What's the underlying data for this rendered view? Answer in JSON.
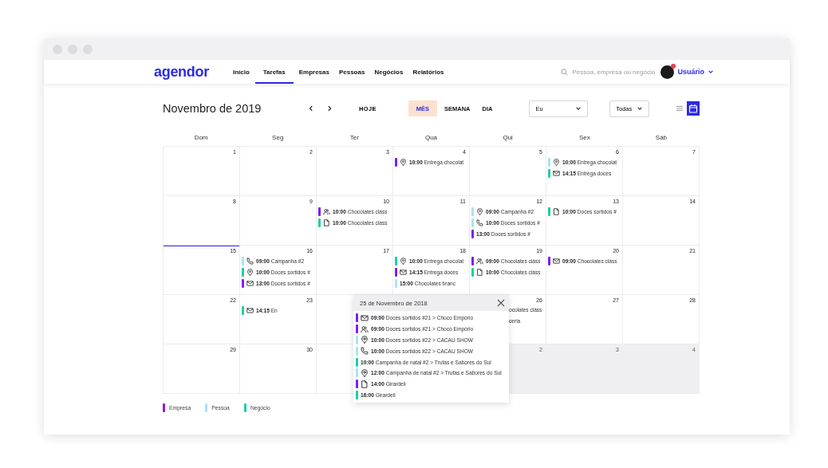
{
  "nav": {
    "logo": "agendor",
    "items": [
      {
        "label": "Início",
        "selected": false
      },
      {
        "label": "Tarefas",
        "selected": true
      },
      {
        "label": "Empresas",
        "selected": false
      },
      {
        "label": "Pessoas",
        "selected": false
      },
      {
        "label": "Negócios",
        "selected": false
      },
      {
        "label": "Relatórios",
        "selected": false
      }
    ],
    "search": {
      "placeholder": "Pessoa, empresa ou negócio"
    },
    "user": {
      "name": "Usuário",
      "notification": true
    }
  },
  "toolbar": {
    "title": "Novembro de 2019",
    "today_button": "HOJE",
    "views": [
      {
        "label": "MÊS",
        "selected": true
      },
      {
        "label": "SEMANA",
        "selected": false
      },
      {
        "label": "DIA",
        "selected": false
      }
    ],
    "filters": [
      {
        "value": "Eu"
      },
      {
        "value": "Todas"
      }
    ],
    "display_modes": [
      {
        "kind": "list",
        "selected": false
      },
      {
        "kind": "calendar",
        "selected": true
      }
    ]
  },
  "calendar": {
    "weekdays": [
      "Dom",
      "Seg",
      "Ter",
      "Qua",
      "Qui",
      "Sex",
      "Sáb"
    ],
    "weeks": [
      [
        {
          "day": "1",
          "today": false,
          "outside": false
        },
        {
          "day": "2",
          "today": false,
          "outside": false
        },
        {
          "day": "3",
          "today": false,
          "outside": false
        },
        {
          "day": "4",
          "today": false,
          "outside": false,
          "events": [
            {
              "time": "10:00",
              "title": "Entrega chocolat",
              "kind": "visit",
              "color": "#7e1ff0"
            }
          ]
        },
        {
          "day": "5",
          "today": false,
          "outside": false
        },
        {
          "day": "6",
          "today": false,
          "outside": false,
          "events": [
            {
              "time": "10:00",
              "title": "Entrega chocolat",
              "kind": "visit",
              "color": "#a9e3f7"
            },
            {
              "time": "14:15",
              "title": "Entrega doces",
              "kind": "email",
              "color": "#1ccfa4"
            }
          ]
        },
        {
          "day": "7",
          "today": false,
          "outside": false
        }
      ],
      [
        {
          "day": "8",
          "today": false,
          "outside": false
        },
        {
          "day": "9",
          "today": false,
          "outside": false
        },
        {
          "day": "10",
          "today": false,
          "outside": false,
          "events": [
            {
              "time": "10:00",
              "title": "Chocolates cláss",
              "kind": "meeting",
              "color": "#7e1ff0"
            },
            {
              "time": "10:00",
              "title": "Chocolates cláss",
              "kind": "proposal",
              "color": "#1ccfa4"
            }
          ]
        },
        {
          "day": "11",
          "today": false,
          "outside": false
        },
        {
          "day": "12",
          "today": false,
          "outside": false,
          "events": [
            {
              "time": "09:00",
              "title": "Campanha #2",
              "kind": "visit",
              "color": "#a9e3f7"
            },
            {
              "time": "10:00",
              "title": "Doces sortidos #",
              "kind": "call",
              "color": "#a9e3f7"
            },
            {
              "time": "13:00",
              "title": "Doces sortidos #",
              "kind": "task",
              "color": "#7e1ff0"
            }
          ]
        },
        {
          "day": "13",
          "today": false,
          "outside": false,
          "events": [
            {
              "time": "10:00",
              "title": "Doces sortidos #",
              "kind": "proposal",
              "color": "#1ccfa4"
            }
          ]
        },
        {
          "day": "14",
          "today": false,
          "outside": false
        }
      ],
      [
        {
          "day": "15",
          "today": true,
          "outside": false
        },
        {
          "day": "16",
          "today": false,
          "outside": false,
          "events": [
            {
              "time": "09:00",
              "title": "Campanha #2",
              "kind": "call",
              "color": "#a9e3f7"
            },
            {
              "time": "10:00",
              "title": "Doces sortidos #",
              "kind": "visit",
              "color": "#1ccfa4"
            },
            {
              "time": "13:00",
              "title": "Doces sortidos #",
              "kind": "email",
              "color": "#7e1ff0"
            }
          ]
        },
        {
          "day": "17",
          "today": false,
          "outside": false
        },
        {
          "day": "18",
          "today": false,
          "outside": false,
          "events": [
            {
              "time": "10:00",
              "title": "Entrega chocolat",
              "kind": "visit",
              "color": "#1ccfa4"
            },
            {
              "time": "14:15",
              "title": "Entrega doces",
              "kind": "email",
              "color": "#7e1ff0"
            },
            {
              "time": "15:00",
              "title": "Chocolates branc",
              "kind": "task",
              "color": "#a9e3f7"
            }
          ]
        },
        {
          "day": "19",
          "today": false,
          "outside": false,
          "events": [
            {
              "time": "09:00",
              "title": "Chocolates cláss",
              "kind": "meeting",
              "color": "#7e1ff0"
            },
            {
              "time": "10:00",
              "title": "Chocolates cláss",
              "kind": "proposal",
              "color": "#1ccfa4"
            }
          ]
        },
        {
          "day": "20",
          "today": false,
          "outside": false,
          "events": [
            {
              "time": "09:00",
              "title": "Chocolates cláss",
              "kind": "email",
              "color": "#7e1ff0"
            }
          ]
        },
        {
          "day": "21",
          "today": false,
          "outside": false
        }
      ],
      [
        {
          "day": "22",
          "today": false,
          "outside": false
        },
        {
          "day": "23",
          "today": false,
          "outside": false,
          "events": [
            {
              "time": "14:15",
              "title": "En",
              "kind": "email",
              "color": "#1ccfa4"
            }
          ]
        },
        {
          "today": false,
          "outside": false
        },
        {
          "day": "26",
          "today": false,
          "outside": false,
          "covered_events": [
            "ocolates cláss",
            "ceria"
          ]
        },
        {
          "day": "27",
          "today": false,
          "outside": false
        },
        {
          "day": "28",
          "today": false,
          "outside": false
        }
      ],
      [
        {
          "day": "29",
          "today": false,
          "outside": false
        },
        {
          "day": "30",
          "today": false,
          "outside": false
        },
        {
          "today": false,
          "outside": false
        },
        {
          "day": "2",
          "today": false,
          "outside": true
        },
        {
          "day": "3",
          "today": false,
          "outside": true
        },
        {
          "day": "4",
          "today": false,
          "outside": true
        }
      ]
    ]
  },
  "popover": {
    "title": "25 de Novembro de 2018",
    "events": [
      {
        "time": "09:00",
        "title": "Doces sortidos #21 > Choco Empório",
        "kind": "email",
        "color": "#7e1ff0"
      },
      {
        "time": "09:00",
        "title": "Doces sortidos #21 > Choco Empório",
        "kind": "meeting",
        "color": "#7e1ff0"
      },
      {
        "time": "10:00",
        "title": "Doces sortidos #22 > CACAU SHOW",
        "kind": "visit",
        "color": "#a9e3f7"
      },
      {
        "time": "10:00",
        "title": "Doces sortidos #22 > CACAU SHOW",
        "kind": "call",
        "color": "#a9e3f7"
      },
      {
        "time": "10:00",
        "title": "Campanha de natal #2 > Trufas e Sabores do Sul",
        "kind": "task",
        "color": "#1ccfa4"
      },
      {
        "time": "12:00",
        "title": "Campanha de natal #2 > Trufas e Sabores do Sul",
        "kind": "visit",
        "color": "#a9e3f7"
      },
      {
        "time": "14:00",
        "title": "Girardeli",
        "kind": "proposal",
        "color": "#7e1ff0"
      },
      {
        "time": "16:00",
        "title": "Girardeli",
        "kind": "task",
        "color": "#1ccfa4"
      }
    ]
  },
  "legend": [
    {
      "label": "Empresa",
      "color": "#7e1ff0"
    },
    {
      "label": "Pessoa",
      "color": "#a9e3f7"
    },
    {
      "label": "Negócio",
      "color": "#1ccfa4"
    }
  ]
}
